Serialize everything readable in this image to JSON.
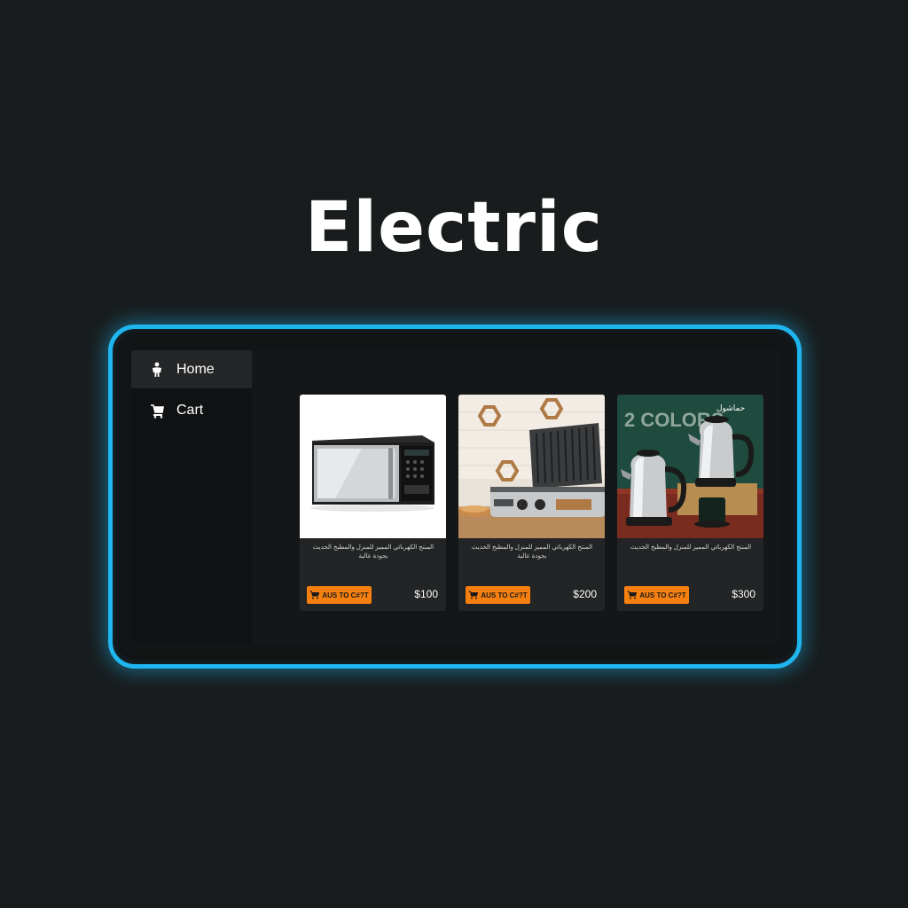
{
  "page": {
    "title": "Electric"
  },
  "sidebar": {
    "items": [
      {
        "label": "Home",
        "icon": "person-icon",
        "active": true
      },
      {
        "label": "Cart",
        "icon": "shopping-cart-icon",
        "active": false
      }
    ]
  },
  "products": [
    {
      "image": "microwave-image",
      "description": "ﺍﻟﻤﻨﺘﺞ ﺍﻟﻜﻬﺮﺑﺎﺋﻲ ﺍﻟﻤﻤﻴﺰ ﻟﻠﻤﻨﺰﻝ ﻭﺍﻟﻤﻄﺒﺦ ﺍﻟﺤﺪﻳﺚ ﺑﺠﻮﺩﺓ ﻋﺎﻟﻴﺔ",
      "button_label": "AUS TO C#?T",
      "price": "$100"
    },
    {
      "image": "grill-image",
      "description": "ﺍﻟﻤﻨﺘﺞ ﺍﻟﻜﻬﺮﺑﺎﺋﻲ ﺍﻟﻤﻤﻴﺰ ﻟﻠﻤﻨﺰﻝ ﻭﺍﻟﻤﻄﺒﺦ ﺍﻟﺤﺪﻳﺚ ﺑﺠﻮﺩﺓ ﻋﺎﻟﻴﺔ",
      "button_label": "AUS TO C#?T",
      "price": "$200"
    },
    {
      "image": "kettle-image",
      "image_caption": "2 COLORS",
      "image_brand": "حماشول",
      "description": "ﺍﻟﻤﻨﺘﺞ ﺍﻟﻜﻬﺮﺑﺎﺋﻲ ﺍﻟﻤﻤﻴﺰ ﻟﻠﻤﻨﺰﻝ ﻭﺍﻟﻤﻄﺒﺦ ﺍﻟﺤﺪﻳﺚ",
      "button_label": "AUS TO C#?T",
      "price": "$300"
    }
  ],
  "colors": {
    "accent_border": "#1fb6f0",
    "button": "#f57f0f",
    "background": "#181c1d"
  }
}
